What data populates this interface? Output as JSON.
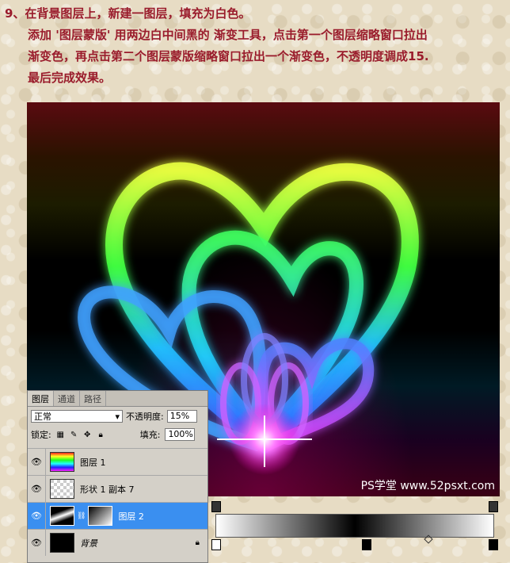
{
  "tutorial": {
    "step_heading": "9、在背景图层上，新建一图层，填充为白色。",
    "step_line1": "添加 '图层蒙版' 用两边白中间黑的 渐变工具，点击第一个图层缩略窗口拉出",
    "step_line2": "渐变色，再点击第二个图层蒙版缩略窗口拉出一个渐变色，不透明度调成15.",
    "step_line3": "最后完成效果。"
  },
  "artwork": {
    "watermark": "PS学堂 www.52psxt.com"
  },
  "layers_panel": {
    "tabs": [
      "图层",
      "通道",
      "路径"
    ],
    "blend_mode": "正常",
    "opacity_label": "不透明度:",
    "opacity_value": "15%",
    "lock_label": "锁定:",
    "fill_label": "填充:",
    "fill_value": "100%",
    "layers": [
      {
        "name": "图层 1",
        "thumb": "rainbow",
        "selected": false
      },
      {
        "name": "形状 1 副本 7",
        "thumb": "transparent",
        "selected": false
      },
      {
        "name": "图层 2",
        "thumb": "gradient-mask",
        "selected": true
      },
      {
        "name": "背景",
        "thumb": "black",
        "selected": false
      }
    ]
  },
  "gradient_editor": {
    "colors": [
      "#ffffff",
      "#000000",
      "#ffffff"
    ]
  }
}
